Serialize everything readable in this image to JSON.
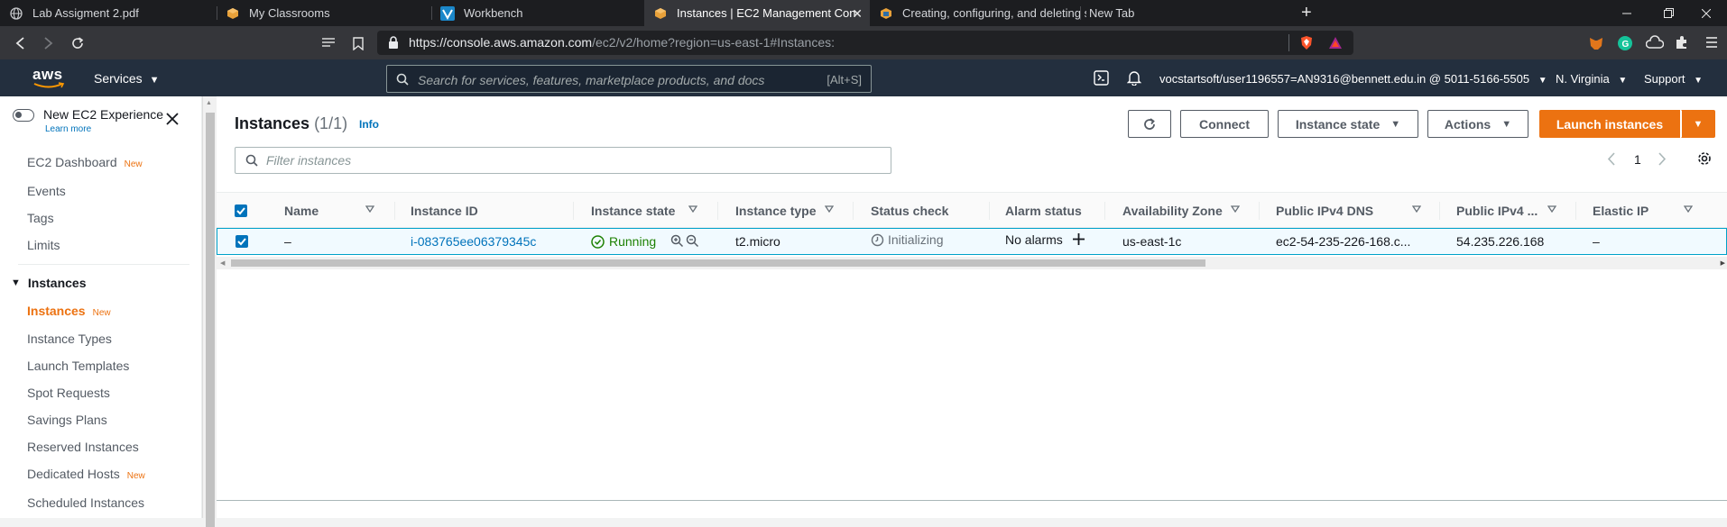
{
  "browser": {
    "tabs": [
      {
        "title": "Lab Assigment 2.pdf",
        "icon": "globe-icon"
      },
      {
        "title": "My Classrooms",
        "icon": "aws-cube-icon"
      },
      {
        "title": "Workbench",
        "icon": "vocareum-icon"
      },
      {
        "title": "Instances | EC2 Management Con",
        "icon": "aws-cube-icon"
      },
      {
        "title": "Creating, configuring, and deleting se",
        "icon": "aws-docs-icon"
      },
      {
        "title": "New Tab",
        "icon": ""
      }
    ],
    "url_host": "https://console.aws.amazon.com",
    "url_path": "/ec2/v2/home?region=us-east-1#Instances:"
  },
  "aws_header": {
    "logo": "aws",
    "services_label": "Services",
    "search_placeholder": "Search for services, features, marketplace products, and docs",
    "search_shortcut": "[Alt+S]",
    "account": "vocstartsoft/user1196557=AN9316@bennett.edu.in @ 5011-5166-5505",
    "region": "N. Virginia",
    "support": "Support"
  },
  "sidebar": {
    "new_experience": "New EC2 Experience",
    "learn_more": "Learn more",
    "top_items": [
      {
        "label": "EC2 Dashboard",
        "badge": "New"
      },
      {
        "label": "Events",
        "badge": ""
      },
      {
        "label": "Tags",
        "badge": ""
      },
      {
        "label": "Limits",
        "badge": ""
      }
    ],
    "section": "Instances",
    "section_items": [
      {
        "label": "Instances",
        "badge": "New"
      },
      {
        "label": "Instance Types",
        "badge": ""
      },
      {
        "label": "Launch Templates",
        "badge": ""
      },
      {
        "label": "Spot Requests",
        "badge": ""
      },
      {
        "label": "Savings Plans",
        "badge": ""
      },
      {
        "label": "Reserved Instances",
        "badge": ""
      },
      {
        "label": "Dedicated Hosts",
        "badge": "New"
      },
      {
        "label": "Scheduled Instances",
        "badge": ""
      }
    ]
  },
  "main": {
    "title": "Instances",
    "count": "(1/1)",
    "info": "Info",
    "buttons": {
      "connect": "Connect",
      "instance_state": "Instance state",
      "actions": "Actions",
      "launch": "Launch instances"
    },
    "filter_placeholder": "Filter instances",
    "page": "1",
    "columns": [
      "Name",
      "Instance ID",
      "Instance state",
      "Instance type",
      "Status check",
      "Alarm status",
      "Availability Zone",
      "Public IPv4 DNS",
      "Public IPv4 ...",
      "Elastic IP"
    ],
    "row": {
      "name": "–",
      "instance_id": "i-083765ee06379345c",
      "state": "Running",
      "type": "t2.micro",
      "status_check": "Initializing",
      "alarm": "No alarms",
      "az": "us-east-1c",
      "dns": "ec2-54-235-226-168.c...",
      "ipv4": "54.235.226.168",
      "elastic_ip": "–"
    }
  }
}
